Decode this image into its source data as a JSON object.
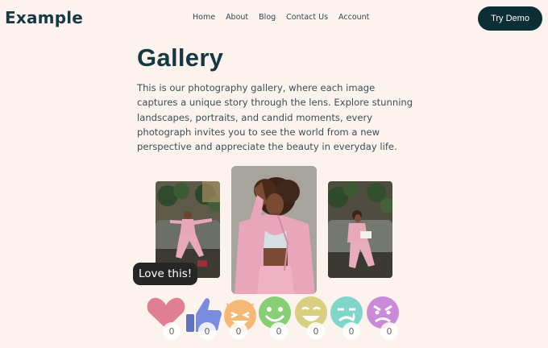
{
  "header": {
    "logo": "Example",
    "nav": [
      "Home",
      "About",
      "Blog",
      "Contact Us",
      "Account"
    ],
    "cta": "Try Demo"
  },
  "main": {
    "title": "Gallery",
    "intro": "This is our photography gallery, where each image captures a unique story through the lens. Explore stunning landscapes, portraits, and candid moments, every photograph invites you to see the world from a new perspective and appreciate the beauty in everyday life."
  },
  "tooltip": "Love this!",
  "reactions": [
    {
      "name": "heart",
      "count": "0"
    },
    {
      "name": "thumbs-up",
      "count": "0"
    },
    {
      "name": "laugh",
      "count": "0"
    },
    {
      "name": "smile",
      "count": "0"
    },
    {
      "name": "grin",
      "count": "0"
    },
    {
      "name": "sad",
      "count": "0"
    },
    {
      "name": "angry",
      "count": "0"
    }
  ]
}
